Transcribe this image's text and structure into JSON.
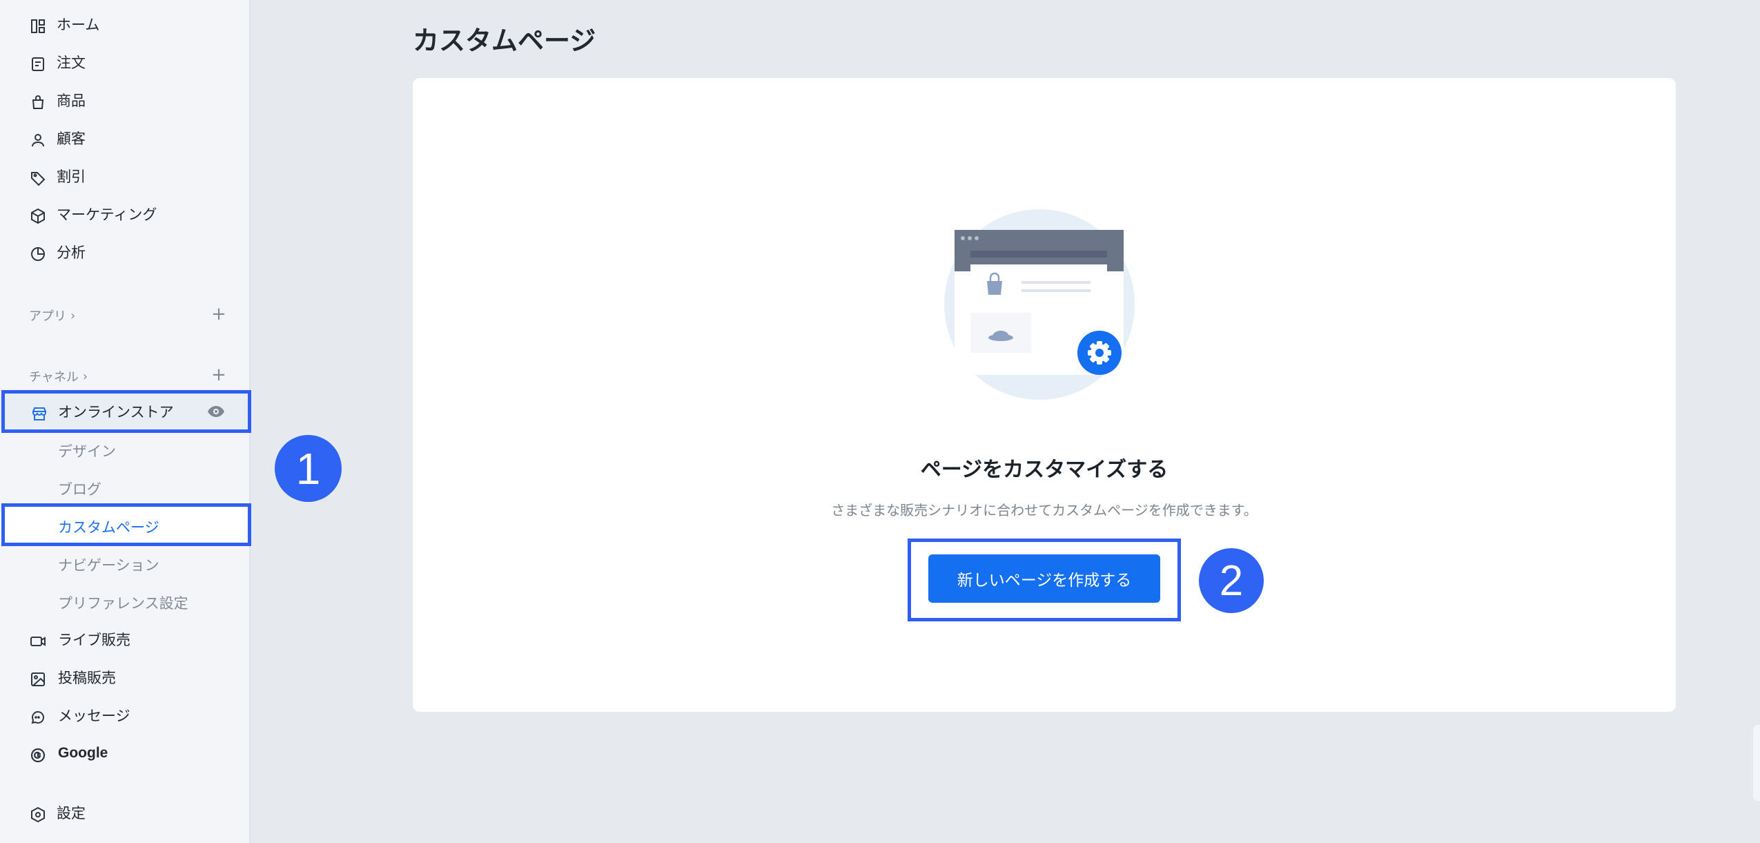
{
  "sidebar": {
    "nav": [
      {
        "label": "ホーム",
        "icon": "home-dashboard-icon"
      },
      {
        "label": "注文",
        "icon": "order-document-icon"
      },
      {
        "label": "商品",
        "icon": "shopping-bag-icon"
      },
      {
        "label": "顧客",
        "icon": "person-icon"
      },
      {
        "label": "割引",
        "icon": "tag-icon"
      },
      {
        "label": "マーケティング",
        "icon": "cube-icon"
      },
      {
        "label": "分析",
        "icon": "pie-chart-icon"
      }
    ],
    "apps_section": "アプリ",
    "channels_section": "チャネル",
    "online_store": "オンラインストア",
    "store_sub": [
      "デザイン",
      "ブログ",
      "カスタムページ",
      "ナビゲーション",
      "プリファレンス設定"
    ],
    "channels": [
      {
        "label": "ライブ販売",
        "icon": "video-camera-icon"
      },
      {
        "label": "投稿販売",
        "icon": "image-post-icon"
      },
      {
        "label": "メッセージ",
        "icon": "chat-bubble-icon"
      },
      {
        "label": "Google",
        "icon": "google-icon"
      }
    ],
    "settings": "設定"
  },
  "main": {
    "page_title": "カスタムページ",
    "empty_title": "ページをカスタマイズする",
    "empty_desc": "さまざまな販売シナリオに合わせてカスタムページを作成できます。",
    "create_button": "新しいページを作成する"
  },
  "annotations": {
    "step1": "1",
    "step2": "2"
  },
  "colors": {
    "accent": "#1470f0",
    "highlight": "#2e5ef2",
    "badge": "#2e63f3"
  }
}
